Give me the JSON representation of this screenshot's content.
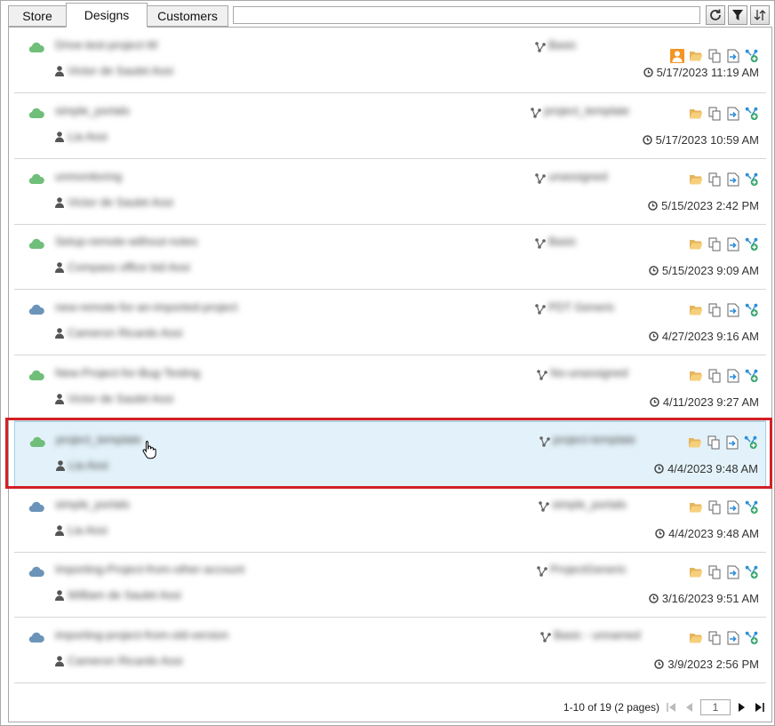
{
  "tabs": [
    {
      "label": "Store",
      "active": false
    },
    {
      "label": "Designs",
      "active": true
    },
    {
      "label": "Customers",
      "active": false
    }
  ],
  "search": {
    "value": "",
    "placeholder": ""
  },
  "toolbar": {
    "icons": [
      "refresh-icon",
      "filter-icon",
      "sort-icon"
    ]
  },
  "colors": {
    "cloud_green": "#6fbf7a",
    "cloud_blue": "#6b94b8",
    "selection": "#e3f2fa",
    "highlight": "#d21f26",
    "accent_blue": "#2f8fd8"
  },
  "rows": [
    {
      "name": "Drive-test-project-W",
      "owner": "Victor de Saulet Assi",
      "branch": "Basic",
      "date": "5/17/2023 11:19 AM",
      "cloud": "green",
      "has_user_badge": true
    },
    {
      "name": "simple_portals",
      "owner": "Lia Assi",
      "branch": "project_template",
      "date": "5/17/2023 10:59 AM",
      "cloud": "green",
      "has_user_badge": false
    },
    {
      "name": "unmonitoring",
      "owner": "Victor de Saulet Assi",
      "branch": "unassigned",
      "date": "5/15/2023 2:42 PM",
      "cloud": "green",
      "has_user_badge": false
    },
    {
      "name": "Setup-remote-without-notes",
      "owner": "Compass office bid Assi",
      "branch": "Basic",
      "date": "5/15/2023 9:09 AM",
      "cloud": "green",
      "has_user_badge": false
    },
    {
      "name": "new-remote-for-an-imported-project",
      "owner": "Cameron Ricardo Assi",
      "branch": "PDT Generic",
      "date": "4/27/2023 9:16 AM",
      "cloud": "blue",
      "has_user_badge": false
    },
    {
      "name": "New-Project-for-Bug-Testing",
      "owner": "Victor de Saulet Assi",
      "branch": "No-unassigned",
      "date": "4/11/2023 9:27 AM",
      "cloud": "green",
      "has_user_badge": false
    },
    {
      "name": "project_template",
      "owner": "Lia Assi",
      "branch": "project-template",
      "date": "4/4/2023 9:48 AM",
      "cloud": "green",
      "has_user_badge": false,
      "selected": true
    },
    {
      "name": "simple_portals",
      "owner": "Lia Assi",
      "branch": "simple_portals",
      "date": "4/4/2023 9:48 AM",
      "cloud": "blue",
      "has_user_badge": false
    },
    {
      "name": "Importing-Project-from-other-account",
      "owner": "William de Saulet Assi",
      "branch": "ProjectGeneric",
      "date": "3/16/2023 9:51 AM",
      "cloud": "blue",
      "has_user_badge": false
    },
    {
      "name": "importing-project-from-old-version",
      "owner": "Cameron Ricardo Assi",
      "branch": "Basic - unnamed",
      "date": "3/9/2023 2:56 PM",
      "cloud": "blue",
      "has_user_badge": false
    }
  ],
  "pager": {
    "summary": "1-10 of 19 (2 pages)",
    "page": "1"
  }
}
